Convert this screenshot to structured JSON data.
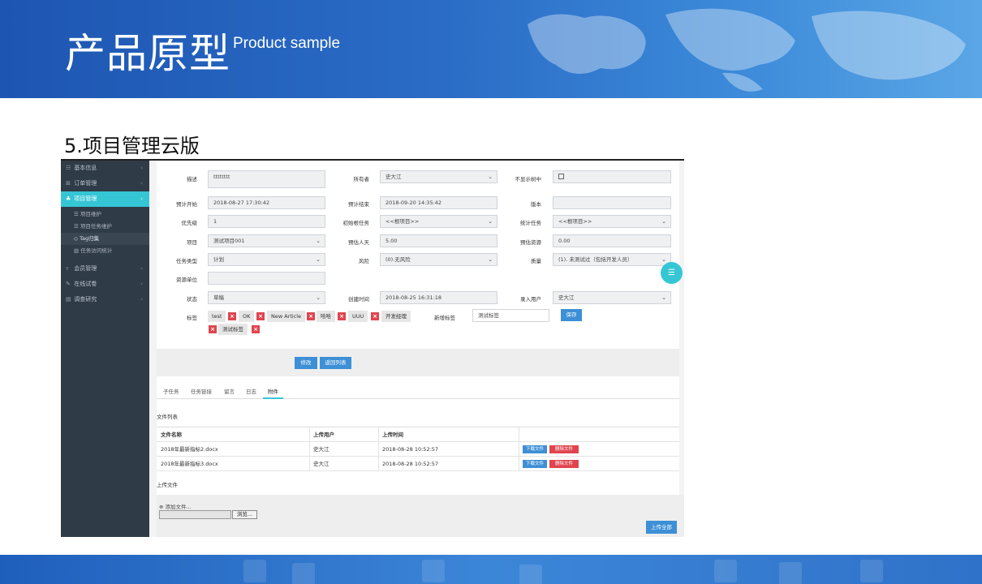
{
  "header": {
    "title_cn": "产品原型",
    "title_en": "Product sample"
  },
  "section_title": "5.项目管理云版",
  "colors": {
    "banner": "#1d56b2",
    "accent": "#35c6d6",
    "sidebar": "#2f3b47",
    "primary_button": "#3d8fd6",
    "danger": "#e0454f"
  },
  "sidebar": {
    "items": [
      {
        "label": "基本信息",
        "icon": "grid-icon",
        "arrow": "‹"
      },
      {
        "label": "订单管理",
        "icon": "cart-icon",
        "arrow": "‹"
      },
      {
        "label": "项目管理",
        "icon": "cluster-icon",
        "arrow": "‹"
      },
      {
        "label": "会员管理",
        "icon": "filter-icon",
        "arrow": "‹"
      },
      {
        "label": "在线试卷",
        "icon": "edit-icon",
        "arrow": "‹"
      },
      {
        "label": "调查研究",
        "icon": "chart-icon",
        "arrow": "‹"
      }
    ],
    "subitems": [
      {
        "label": "项目维护",
        "icon": "list-icon"
      },
      {
        "label": "项目任务维护",
        "icon": "list-icon"
      },
      {
        "label": "Tag归集",
        "icon": "tag-icon"
      },
      {
        "label": "任务访问统计",
        "icon": "bar-icon"
      }
    ]
  },
  "form": {
    "desc": {
      "label": "描述",
      "value": "tttttttt"
    },
    "owner": {
      "label": "所有者",
      "value": "史大江"
    },
    "hide_in_tree": {
      "label": "不显示树中"
    },
    "plan_start": {
      "label": "预计开始",
      "value": "2018-08-27 17:30:42"
    },
    "plan_end": {
      "label": "预计结束",
      "value": "2018-09-20 14:35:42"
    },
    "version": {
      "label": "版本",
      "value": ""
    },
    "priority": {
      "label": "优先级",
      "value": "1"
    },
    "init_root_task": {
      "label": "初始根任务",
      "value": "<<根项目>>"
    },
    "stat_task": {
      "label": "统计任务",
      "value": "<<根项目>>"
    },
    "project": {
      "label": "项目",
      "value": "测试项目001"
    },
    "est_days": {
      "label": "预估人天",
      "value": "5.00"
    },
    "est_resource": {
      "label": "预估资源",
      "value": "0.00"
    },
    "task_type": {
      "label": "任务类型",
      "value": "计划"
    },
    "risk": {
      "label": "风险",
      "value": "(0).无风险"
    },
    "quality": {
      "label": "质量",
      "value": "(1). 未测试过（包括开发人员）"
    },
    "resource_unit": {
      "label": "资源单位",
      "value": ""
    },
    "status": {
      "label": "状态",
      "value": "草稿"
    },
    "created_at": {
      "label": "创建时间",
      "value": "2018-08-25 16:31:18"
    },
    "entry_user": {
      "label": "录入用户",
      "value": "史大江"
    },
    "tags_label": "标签",
    "tags": [
      "test",
      "OK",
      "New Article",
      "哈哈",
      "UUU",
      "开发经理",
      "测试标签"
    ],
    "new_tag": {
      "label": "新增标签",
      "value": "测试标签"
    },
    "save_label": "保存",
    "modify_label": "修改",
    "back_label": "返回列表"
  },
  "tabs": [
    "子任务",
    "任务链接",
    "留言",
    "日志",
    "附件"
  ],
  "files": {
    "title": "文件列表",
    "headers": [
      "文件名称",
      "上传用户",
      "上传时间"
    ],
    "rows": [
      {
        "name": "2018年最新指标2.docx",
        "user": "史大江",
        "time": "2018-08-28 10:52:57"
      },
      {
        "name": "2018年最新指标3.docx",
        "user": "史大江",
        "time": "2018-08-28 10:52:57"
      }
    ],
    "download_label": "下载文件",
    "delete_label": "删除文件"
  },
  "upload": {
    "title": "上传文件",
    "add_file_label": "添加文件...",
    "browse_label": "浏览...",
    "upload_all_label": "上传全部"
  },
  "float_button_icon": "menu-icon"
}
